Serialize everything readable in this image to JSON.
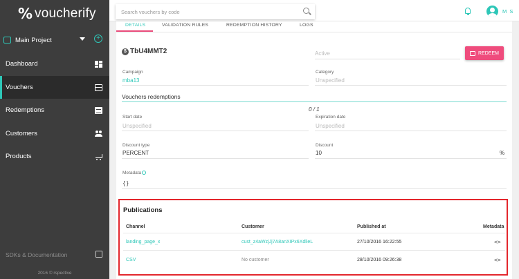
{
  "app": {
    "logo_mark": "%",
    "logo_text": "voucherify",
    "project": "Main Project",
    "project_add": "+"
  },
  "sidebar": {
    "items": [
      {
        "label": "Dashboard",
        "icon": "dashboard-icon",
        "active": false
      },
      {
        "label": "Vouchers",
        "icon": "gift-icon",
        "active": true
      },
      {
        "label": "Redemptions",
        "icon": "list-icon",
        "active": false
      },
      {
        "label": "Customers",
        "icon": "people-icon",
        "active": false
      },
      {
        "label": "Products",
        "icon": "cart-icon",
        "active": false
      }
    ],
    "sdk_label": "SDKs & Documentation",
    "copyright": "2016 © rspective"
  },
  "topbar": {
    "search_placeholder": "Search vouchers by code",
    "user_initials": "M S"
  },
  "tabs": [
    "DETAILS",
    "VALIDATION RULES",
    "REDEMPTION HISTORY",
    "LOGS"
  ],
  "voucher": {
    "code": "TbU4MMT2",
    "status": "Active",
    "redeem_label": "REDEEM",
    "campaign_label": "Campaign",
    "campaign": "mba13",
    "category_label": "Category",
    "category": "Unspecified",
    "redemptions_title": "Vouchers redemptions",
    "redemptions_text": "0 / 1",
    "redemptions_progress": 0,
    "start_date_label": "Start date",
    "start_date": "Unspecified",
    "expiration_label": "Expiration date",
    "expiration": "Unspecified",
    "discount_type_label": "Discount type",
    "discount_type": "PERCENT",
    "discount_label": "Discount",
    "discount": "10",
    "discount_unit": "%",
    "metadata_label": "Metadata",
    "metadata": "{ }"
  },
  "publications": {
    "title": "Publications",
    "columns": [
      "Channel",
      "Customer",
      "Published at",
      "Metadata"
    ],
    "rows": [
      {
        "channel": "landing_page_x",
        "customer": "cust_z4aWzjJj7A8anXIPx6XdlieL",
        "published_at": "27/10/2016 16:22:55",
        "metadata": "<>"
      },
      {
        "channel": "CSV",
        "customer": "No customer",
        "published_at": "28/10/2016 09:26:38",
        "metadata": "<>"
      }
    ]
  },
  "colors": {
    "accent": "#2ec7b8",
    "redeem": "#ef4c7d",
    "sidebar": "#3d3d3d",
    "highlight_border": "#e3262c"
  }
}
